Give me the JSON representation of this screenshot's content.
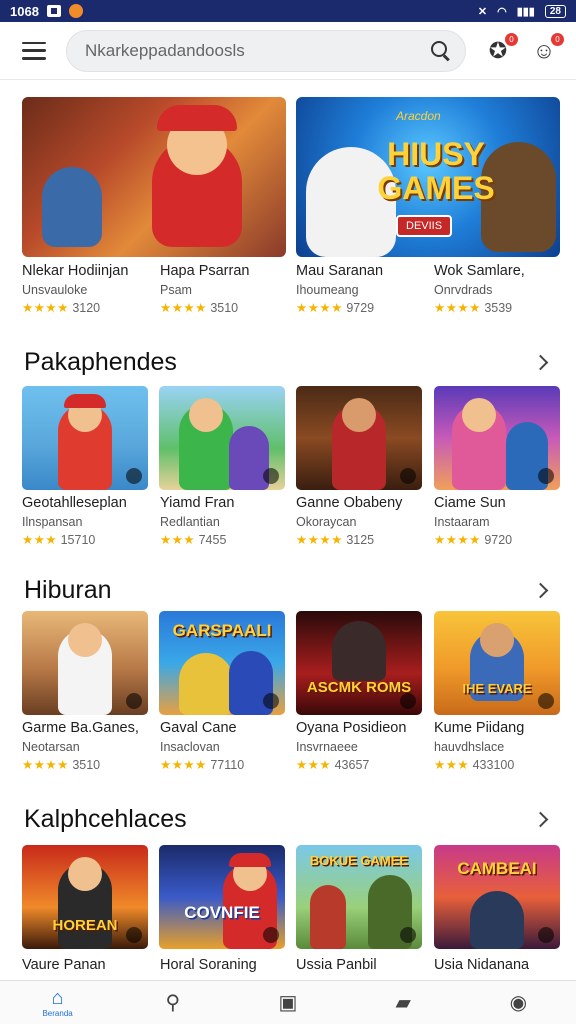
{
  "status_bar": {
    "time": "1068",
    "battery": "28"
  },
  "search": {
    "placeholder": "Nkarkeppadandoosls"
  },
  "topbar": {
    "notifications_badge": "0",
    "profile_badge": "0"
  },
  "featured": [
    {
      "title": "Nlekar Hodiinjan",
      "subtitle": "Unsvauloke",
      "stars": "★★★★",
      "rating": "3120"
    },
    {
      "title": "Hapa Psarran",
      "subtitle": "Psam",
      "stars": "★★★★",
      "rating": "3510"
    },
    {
      "title": "Mau Saranan",
      "subtitle": "Ihoumeang",
      "stars": "★★★★",
      "rating": "9729"
    },
    {
      "title": "Wok Samlare,",
      "subtitle": "Onrvdrads",
      "stars": "★★★★",
      "rating": "3539"
    }
  ],
  "featured_banner": {
    "headline_small": "Aracdon",
    "headline": "HIUSY GAMES",
    "badge": "DEVIIS"
  },
  "sections": [
    {
      "title": "Pakaphendes",
      "items": [
        {
          "title": "Geotahlleseplan",
          "subtitle": "Ilnspansan",
          "stars": "★★★",
          "rating": "15710"
        },
        {
          "title": "Yiamd Fran",
          "subtitle": "Redlantian",
          "stars": "★★★",
          "rating": "7455"
        },
        {
          "title": "Ganne Obabeny",
          "subtitle": "Okoraycan",
          "stars": "★★★★",
          "rating": "3125"
        },
        {
          "title": "Ciame Sun",
          "subtitle": "Instaaram",
          "stars": "★★★★",
          "rating": "9720"
        }
      ]
    },
    {
      "title": "Hiburan",
      "items": [
        {
          "title": "Garme Ba.Ganes,",
          "subtitle": "Neotarsan",
          "stars": "★★★★",
          "rating": "3510",
          "tile_text": ""
        },
        {
          "title": "Gaval Cane",
          "subtitle": "Insaclovan",
          "stars": "★★★★",
          "rating": "77110",
          "tile_text": "GARSPAALI"
        },
        {
          "title": "Oyana Posidieon",
          "subtitle": "Insvrnaeee",
          "stars": "★★★",
          "rating": "43657",
          "tile_text": "ASCMK ROMS"
        },
        {
          "title": "Kume Piidang",
          "subtitle": "hauvdhslace",
          "stars": "★★★",
          "rating": "433100",
          "tile_text": "IHE EVARE"
        }
      ]
    },
    {
      "title": "Kalphcehlaces",
      "items": [
        {
          "title": "Vaure Panan",
          "tile_text": "HOREAN"
        },
        {
          "title": "Horal Soraning",
          "tile_text": "COVNFIE"
        },
        {
          "title": "Ussia Panbil",
          "tile_text": "BOKUE GAMEE"
        },
        {
          "title": "Usia Nidanana",
          "tile_text": "CAMBEAI"
        }
      ]
    }
  ],
  "bottom_nav": {
    "home_label": "Beranda"
  }
}
